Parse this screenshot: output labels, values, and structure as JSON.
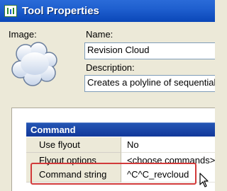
{
  "window": {
    "title": "Tool Properties",
    "icon": "tool-properties-app-icon"
  },
  "image": {
    "label": "Image:",
    "icon": "revision-cloud-icon"
  },
  "name": {
    "label": "Name:",
    "value": "Revision Cloud"
  },
  "description": {
    "label": "Description:",
    "value": "Creates a polyline of sequential"
  },
  "command_section": {
    "title": "Command",
    "rows": [
      {
        "name": "Use flyout",
        "value": "No"
      },
      {
        "name": "Flyout options",
        "value": "<choose commands>"
      },
      {
        "name": "Command string",
        "value": "^C^C_revcloud"
      }
    ],
    "highlight_color": "#d23a3a"
  },
  "colors": {
    "titlebar": "#0a47b8",
    "section_header": "#12389a",
    "dialog_background": "#ece9d8"
  }
}
